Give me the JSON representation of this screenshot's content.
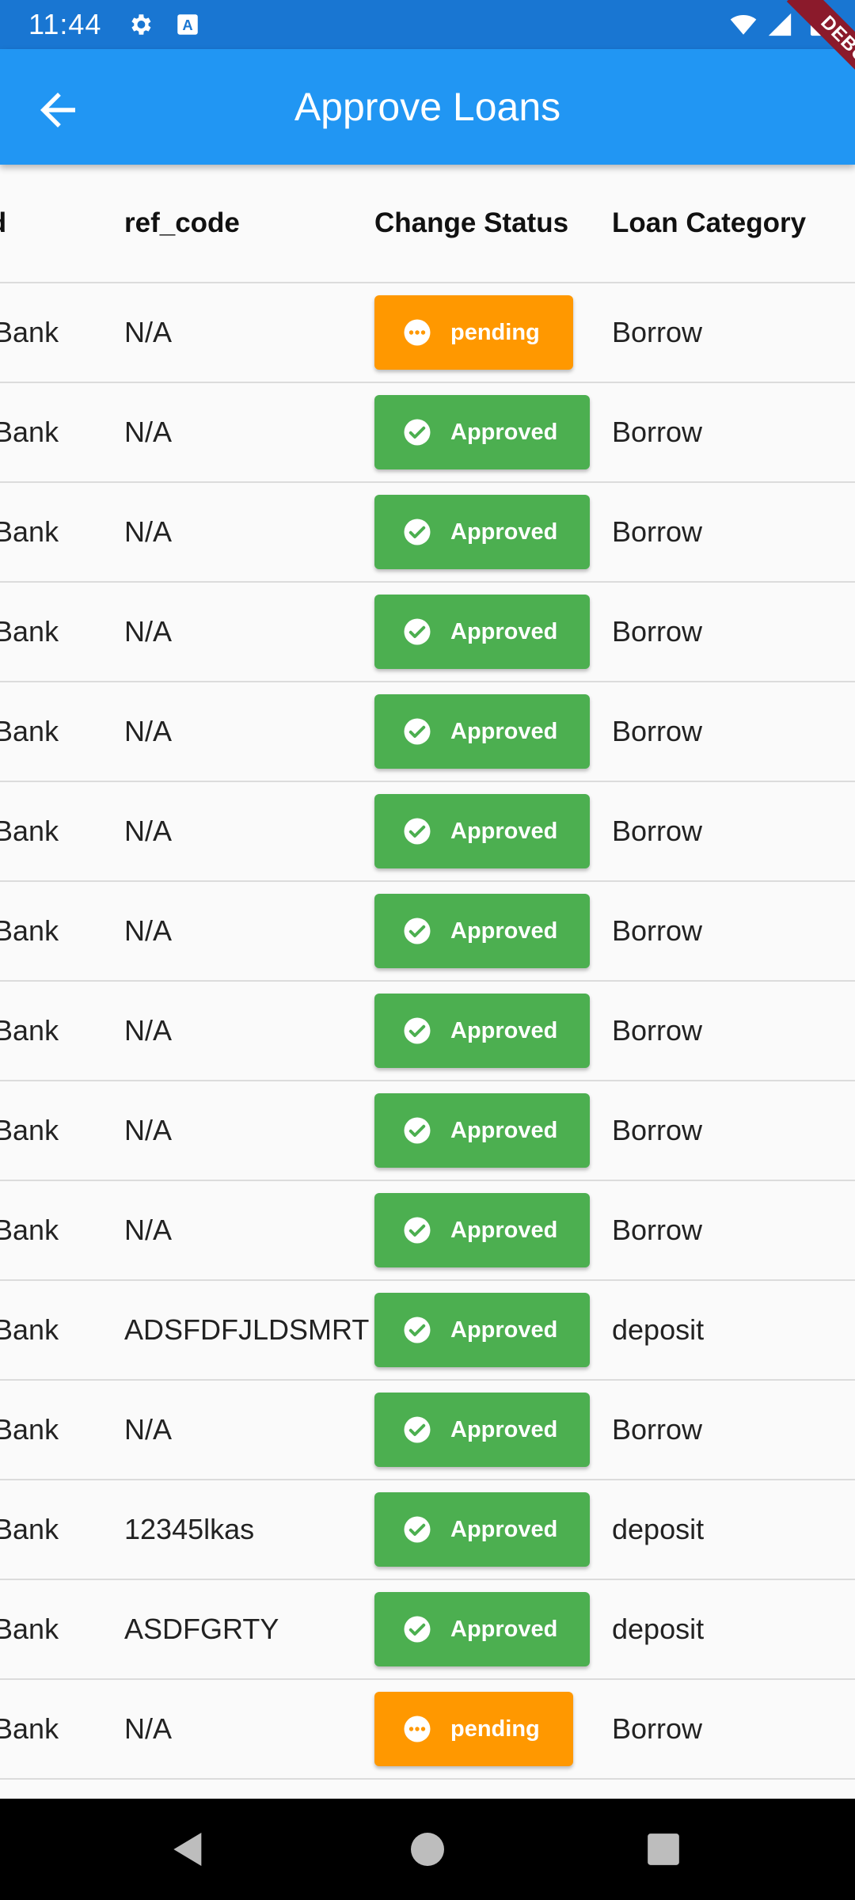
{
  "status_bar": {
    "time": "11:44",
    "icons": [
      "settings-icon",
      "keyboard-icon",
      "wifi-icon",
      "signal-icon",
      "battery-icon"
    ]
  },
  "app_bar": {
    "title": "Approve Loans",
    "back_icon": "arrow-back-icon"
  },
  "debug_banner": "DEBUG",
  "table": {
    "columns": [
      "hod",
      "ref_code",
      "Change Status",
      "Loan Category"
    ],
    "rows": [
      {
        "method": "sa/Bank",
        "ref_code": "N/A",
        "status": "pending",
        "category": "Borrow"
      },
      {
        "method": "sa/Bank",
        "ref_code": "N/A",
        "status": "Approved",
        "category": "Borrow"
      },
      {
        "method": "sa/Bank",
        "ref_code": "N/A",
        "status": "Approved",
        "category": "Borrow"
      },
      {
        "method": "sa/Bank",
        "ref_code": "N/A",
        "status": "Approved",
        "category": "Borrow"
      },
      {
        "method": "sa/Bank",
        "ref_code": "N/A",
        "status": "Approved",
        "category": "Borrow"
      },
      {
        "method": "sa/Bank",
        "ref_code": "N/A",
        "status": "Approved",
        "category": "Borrow"
      },
      {
        "method": "sa/Bank",
        "ref_code": "N/A",
        "status": "Approved",
        "category": "Borrow"
      },
      {
        "method": "sa/Bank",
        "ref_code": "N/A",
        "status": "Approved",
        "category": "Borrow"
      },
      {
        "method": "sa/Bank",
        "ref_code": "N/A",
        "status": "Approved",
        "category": "Borrow"
      },
      {
        "method": "sa/Bank",
        "ref_code": "N/A",
        "status": "Approved",
        "category": "Borrow"
      },
      {
        "method": "sa/Bank",
        "ref_code": "ADSFDFJLDSMRT",
        "status": "Approved",
        "category": "deposit"
      },
      {
        "method": "sa/Bank",
        "ref_code": "N/A",
        "status": "Approved",
        "category": "Borrow"
      },
      {
        "method": "sa/Bank",
        "ref_code": "12345lkas",
        "status": "Approved",
        "category": "deposit"
      },
      {
        "method": "sa/Bank",
        "ref_code": "ASDFGRTY",
        "status": "Approved",
        "category": "deposit"
      },
      {
        "method": "sa/Bank",
        "ref_code": "N/A",
        "status": "pending",
        "category": "Borrow"
      },
      {
        "method": "",
        "ref_code": "",
        "status": "",
        "category": ""
      }
    ]
  },
  "colors": {
    "status_bar": "#1976d2",
    "app_bar": "#2196f3",
    "pending": "#ff9800",
    "approved": "#4caf50",
    "debug": "#8b1a2b"
  },
  "nav_bar": {
    "buttons": [
      "back-triangle-icon",
      "home-circle-icon",
      "recents-square-icon"
    ]
  }
}
